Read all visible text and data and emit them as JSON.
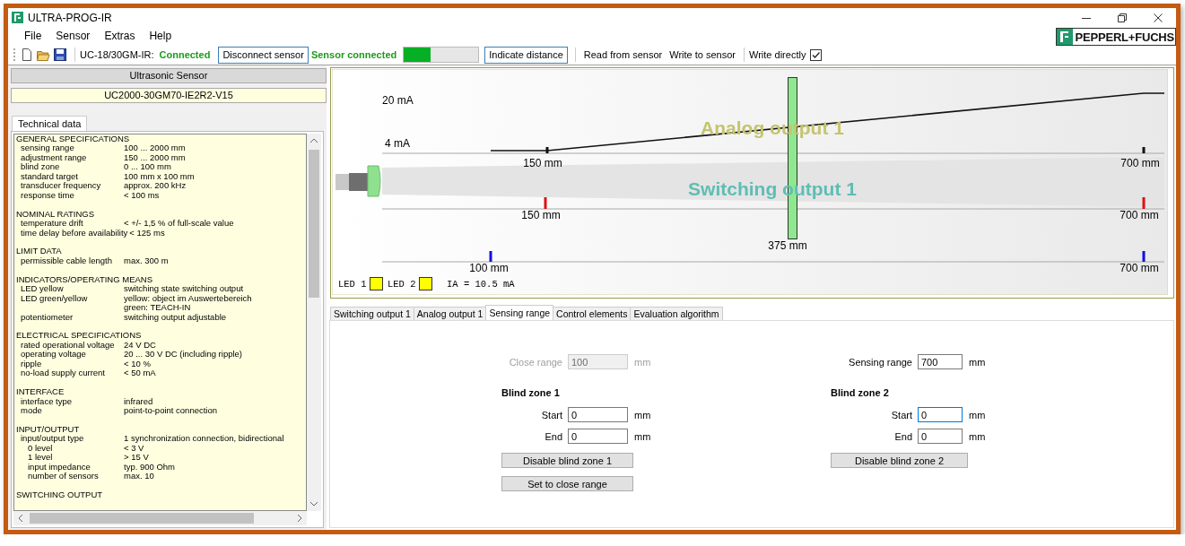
{
  "window": {
    "title": "ULTRA-PROG-IR"
  },
  "menu": [
    "File",
    "Sensor",
    "Extras",
    "Help"
  ],
  "logo": {
    "text": "PEPPERL+FUCHS"
  },
  "toolbar": {
    "device_label": "UC-18/30GM-IR:",
    "connection_status": "Connected",
    "disconnect_button": "Disconnect sensor",
    "sensor_status": "Sensor connected",
    "signal": {
      "level": 0.36
    },
    "indicate_button": "Indicate distance",
    "read_button": "Read from sensor",
    "write_button": "Write to sensor",
    "write_directly": {
      "label": "Write directly",
      "checked": true
    }
  },
  "sensor_panel": {
    "header": "Ultrasonic Sensor",
    "model": "UC2000-30GM70-IE2R2-V15",
    "tab": "Technical data",
    "sections": [
      {
        "title": "GENERAL SPECIFICATIONS",
        "rows": [
          {
            "label": "sensing range",
            "value": "100 ... 2000 mm"
          },
          {
            "label": "adjustment range",
            "value": "150 ... 2000 mm"
          },
          {
            "label": "blind zone",
            "value": "0 ... 100 mm"
          },
          {
            "label": "standard target",
            "value": "100 mm x 100 mm"
          },
          {
            "label": "transducer frequency",
            "value": "approx. 200 kHz"
          },
          {
            "label": "response time",
            "value": "< 100 ms"
          }
        ]
      },
      {
        "title": "NOMINAL RATINGS",
        "rows": [
          {
            "label": "temperature drift",
            "value": "< +/- 1,5 % of full-scale value"
          },
          {
            "label": "time delay before availability",
            "value": "< 125 ms"
          }
        ]
      },
      {
        "title": "LIMIT DATA",
        "rows": [
          {
            "label": "permissible cable length",
            "value": "max. 300 m"
          }
        ]
      },
      {
        "title": "INDICATORS/OPERATING MEANS",
        "rows": [
          {
            "label": "LED yellow",
            "value": "switching state switching output"
          },
          {
            "label": "LED green/yellow",
            "value": "yellow: object im Auswertebereich"
          },
          {
            "value": "green: TEACH-IN"
          },
          {
            "label": "potentiometer",
            "value": "switching output adjustable"
          }
        ]
      },
      {
        "title": "ELECTRICAL SPECIFICATIONS",
        "rows": [
          {
            "label": "rated operational voltage",
            "value": "24 V DC"
          },
          {
            "label": "operating voltage",
            "value": "20 ... 30 V DC (including ripple)"
          },
          {
            "label": "ripple",
            "value": "< 10 %"
          },
          {
            "label": "no-load supply current",
            "value": "< 50 mA"
          }
        ]
      },
      {
        "title": "INTERFACE",
        "rows": [
          {
            "label": "interface type",
            "value": "infrared"
          },
          {
            "label": "mode",
            "value": "point-to-point connection"
          }
        ]
      },
      {
        "title": "INPUT/OUTPUT",
        "rows": [
          {
            "label": "input/output type",
            "value": "1 synchronization connection, bidirectional",
            "children": [
              {
                "label": "0 level",
                "value": "< 3 V"
              },
              {
                "label": "1 level",
                "value": "> 15 V"
              },
              {
                "label": "input impedance",
                "value": "typ. 900 Ohm"
              },
              {
                "label": "number of sensors",
                "value": "max. 10"
              }
            ]
          }
        ]
      },
      {
        "title": "SWITCHING OUTPUT"
      }
    ]
  },
  "diagram": {
    "current_max": "20 mA",
    "current_min": "4 mA",
    "analog_title": "Analog output 1",
    "switching_title": "Switching output 1",
    "analog_marks": [
      "150 mm",
      "700 mm"
    ],
    "switching_marks": [
      "150 mm",
      "700 mm"
    ],
    "target": "375 mm",
    "range_marks": [
      "100 mm",
      "700 mm"
    ],
    "leds": [
      {
        "label": "LED 1",
        "on": true
      },
      {
        "label": "LED 2",
        "on": true
      }
    ],
    "current_reading": "IA = 10.5 mA"
  },
  "tabs": [
    {
      "label": "Switching output 1",
      "selected": false
    },
    {
      "label": "Analog output 1",
      "selected": false
    },
    {
      "label": "Sensing range",
      "selected": true
    },
    {
      "label": "Control elements",
      "selected": false
    },
    {
      "label": "Evaluation algorithm",
      "selected": false
    }
  ],
  "sensing_range": {
    "close_range": {
      "label": "Close range",
      "value": "100",
      "unit": "mm",
      "disabled": true
    },
    "sensing_range": {
      "label": "Sensing range",
      "value": "700",
      "unit": "mm",
      "disabled": false
    },
    "blind_zones": [
      {
        "title": "Blind zone 1",
        "fields": [
          {
            "label": "Start",
            "value": "0",
            "unit": "mm",
            "focused": false
          },
          {
            "label": "End",
            "value": "0",
            "unit": "mm",
            "focused": false
          }
        ],
        "buttons": [
          "Disable blind zone 1",
          "Set to close range"
        ]
      },
      {
        "title": "Blind zone 2",
        "fields": [
          {
            "label": "Start",
            "value": "0",
            "unit": "mm",
            "focused": true
          },
          {
            "label": "End",
            "value": "0",
            "unit": "mm",
            "focused": false
          }
        ],
        "buttons": [
          "Disable blind zone 2"
        ]
      }
    ]
  }
}
